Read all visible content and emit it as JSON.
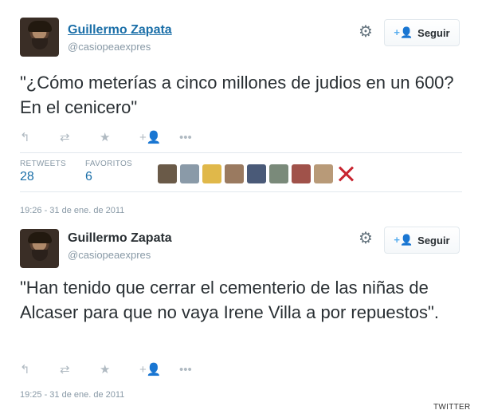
{
  "tweets": [
    {
      "author_name": "Guillermo Zapata",
      "handle": "@casiopeaexpres",
      "follow_label": "Seguir",
      "text": "\"¿Cómo meterías a cinco millones de judios en un 600? En el cenicero\"",
      "actions": {
        "reply": "↰",
        "retweet": "⇄",
        "favorite": "★",
        "follow": "+👤",
        "more": "•••"
      },
      "retweets_label": "RETWEETS",
      "retweets_count": "28",
      "favorites_label": "FAVORITOS",
      "favorites_count": "6",
      "timestamp": "19:26 - 31 de ene. de 2011"
    },
    {
      "author_name": "Guillermo Zapata",
      "handle": "@casiopeaexpres",
      "follow_label": "Seguir",
      "text": "\"Han tenido que cerrar el cementerio de las niñas de Alcaser para que no vaya Irene Villa a por repuestos\".",
      "actions": {
        "reply": "↰",
        "retweet": "⇄",
        "favorite": "★",
        "follow": "+👤",
        "more": "•••"
      },
      "timestamp": "19:25 - 31 de ene. de 2011"
    }
  ],
  "favoriter_colors": [
    "#6a5a48",
    "#8a9aa8",
    "#e0b84a",
    "#9a7a60",
    "#4a5a78",
    "#7a8a7a",
    "#a0524a",
    "#b89a78"
  ],
  "icons": {
    "gear": "gear-icon",
    "follow": "add-user-icon",
    "reply": "reply-icon",
    "retweet": "retweet-icon",
    "favorite": "star-icon",
    "more": "more-icon"
  },
  "credit": "TWITTER"
}
